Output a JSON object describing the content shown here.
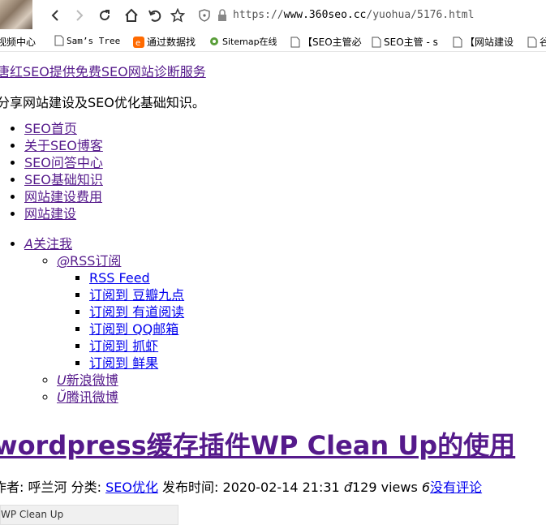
{
  "browser": {
    "url_prefix": "https://",
    "url_host": "www.360seo.cc",
    "url_path": "/yuohua/5176.html"
  },
  "bookmarks": [
    {
      "label": "视频中心"
    },
    {
      "label": "Sam’s Tree"
    },
    {
      "label": "通过数据找"
    },
    {
      "label": "Sitemap在线"
    },
    {
      "label": "【SEO主管必"
    },
    {
      "label": "SEO主管 - s"
    },
    {
      "label": "【网站建设"
    },
    {
      "label": "谷"
    }
  ],
  "site": {
    "name_link": "唐红SEO提供免费SEO网站诊断服务",
    "description": "分享网站建设及SEO优化基础知识。"
  },
  "nav": [
    "SEO首页",
    "关于SEO博客",
    "SEO问答中心",
    "SEO基础知识",
    "网站建设费用",
    "网站建设"
  ],
  "follow": {
    "label": "关注我",
    "rss_label": "RSS订阅",
    "rss_items": [
      "RSS Feed",
      "订阅到 豆瓣九点",
      "订阅到 有道阅读",
      "订阅到 QQ邮箱",
      "订阅到 抓虾",
      "订阅到 鲜果"
    ],
    "weibo_sina": "新浪微博",
    "weibo_qq": "腾讯微博"
  },
  "article": {
    "title": "wordpress缓存插件WP Clean Up的使用",
    "author_label": "作者: 呼兰河",
    "category_label": "分类:",
    "category": "SEO优化",
    "date_label": "发布时间: 2020-02-14 21:31",
    "views": "129 views",
    "comments": "没有评论",
    "image_alt": "WP Clean Up"
  },
  "colors": {
    "visited_link": "#551a8b",
    "link": "#0000ee"
  }
}
